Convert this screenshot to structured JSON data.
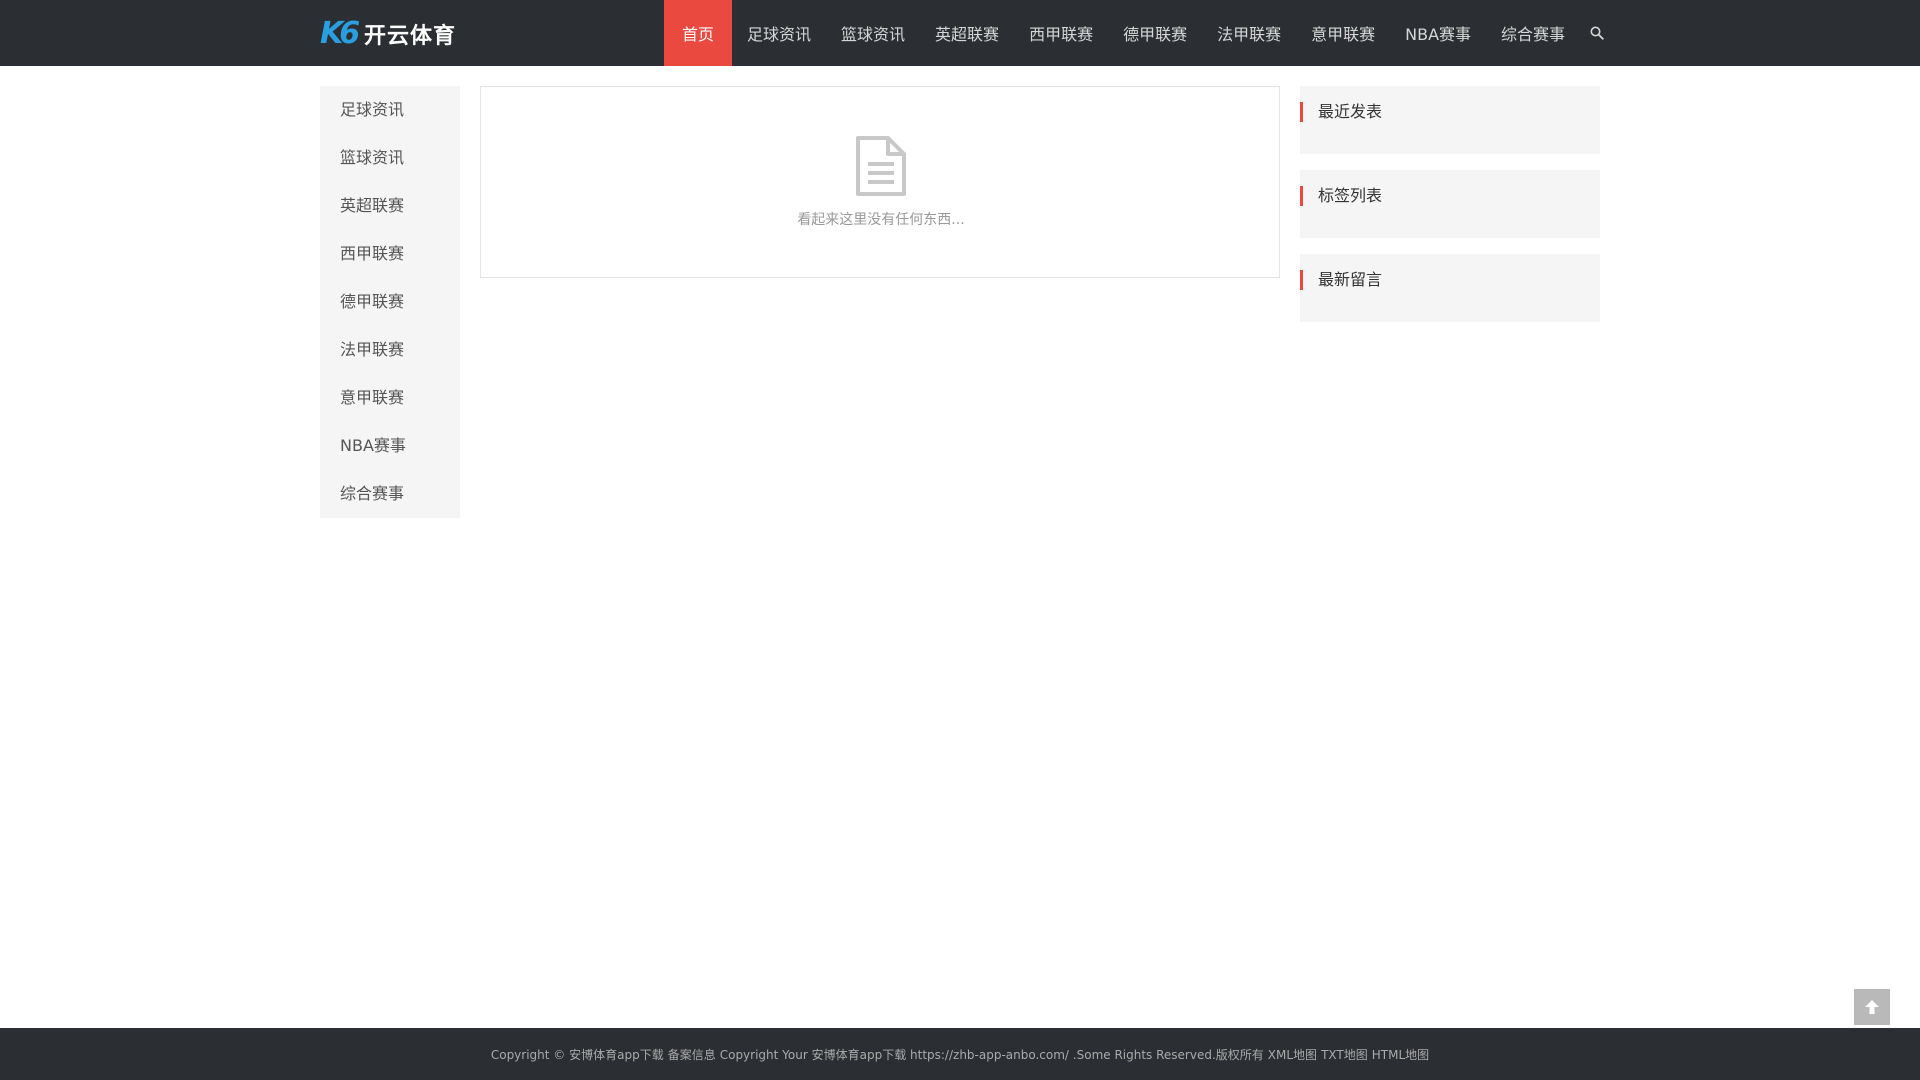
{
  "brand": {
    "logo_mark": "K6",
    "logo_text": "开云体育"
  },
  "nav": {
    "items": [
      {
        "label": "首页",
        "active": true
      },
      {
        "label": "足球资讯"
      },
      {
        "label": "篮球资讯"
      },
      {
        "label": "英超联赛"
      },
      {
        "label": "西甲联赛"
      },
      {
        "label": "德甲联赛"
      },
      {
        "label": "法甲联赛"
      },
      {
        "label": "意甲联赛"
      },
      {
        "label": "NBA赛事"
      },
      {
        "label": "综合赛事"
      }
    ],
    "search_icon": "search-icon"
  },
  "sidebar": {
    "items": [
      {
        "label": "足球资讯"
      },
      {
        "label": "篮球资讯"
      },
      {
        "label": "英超联赛"
      },
      {
        "label": "西甲联赛"
      },
      {
        "label": "德甲联赛"
      },
      {
        "label": "法甲联赛"
      },
      {
        "label": "意甲联赛"
      },
      {
        "label": "NBA赛事"
      },
      {
        "label": "综合赛事"
      }
    ]
  },
  "main": {
    "empty_icon": "document-icon",
    "empty_text": "看起来这里没有任何东西..."
  },
  "widgets": [
    {
      "title": "最近发表"
    },
    {
      "title": "标签列表"
    },
    {
      "title": "最新留言"
    }
  ],
  "footer": {
    "copyright": "Copyright © 安博体育app下载",
    "beian": "备案信息",
    "copyright2": "Copyright Your 安博体育app下载 https://zhb-app-anbo.com/ .Some Rights Reserved.版权所有",
    "xml_map": "XML地图",
    "txt_map": "TXT地图",
    "html_map": "HTML地图"
  },
  "colors": {
    "accent": "#e9493f",
    "header_bg": "#2b2e33",
    "panel_bg": "#f5f5f5"
  },
  "back_to_top_icon": "arrow-up-icon"
}
